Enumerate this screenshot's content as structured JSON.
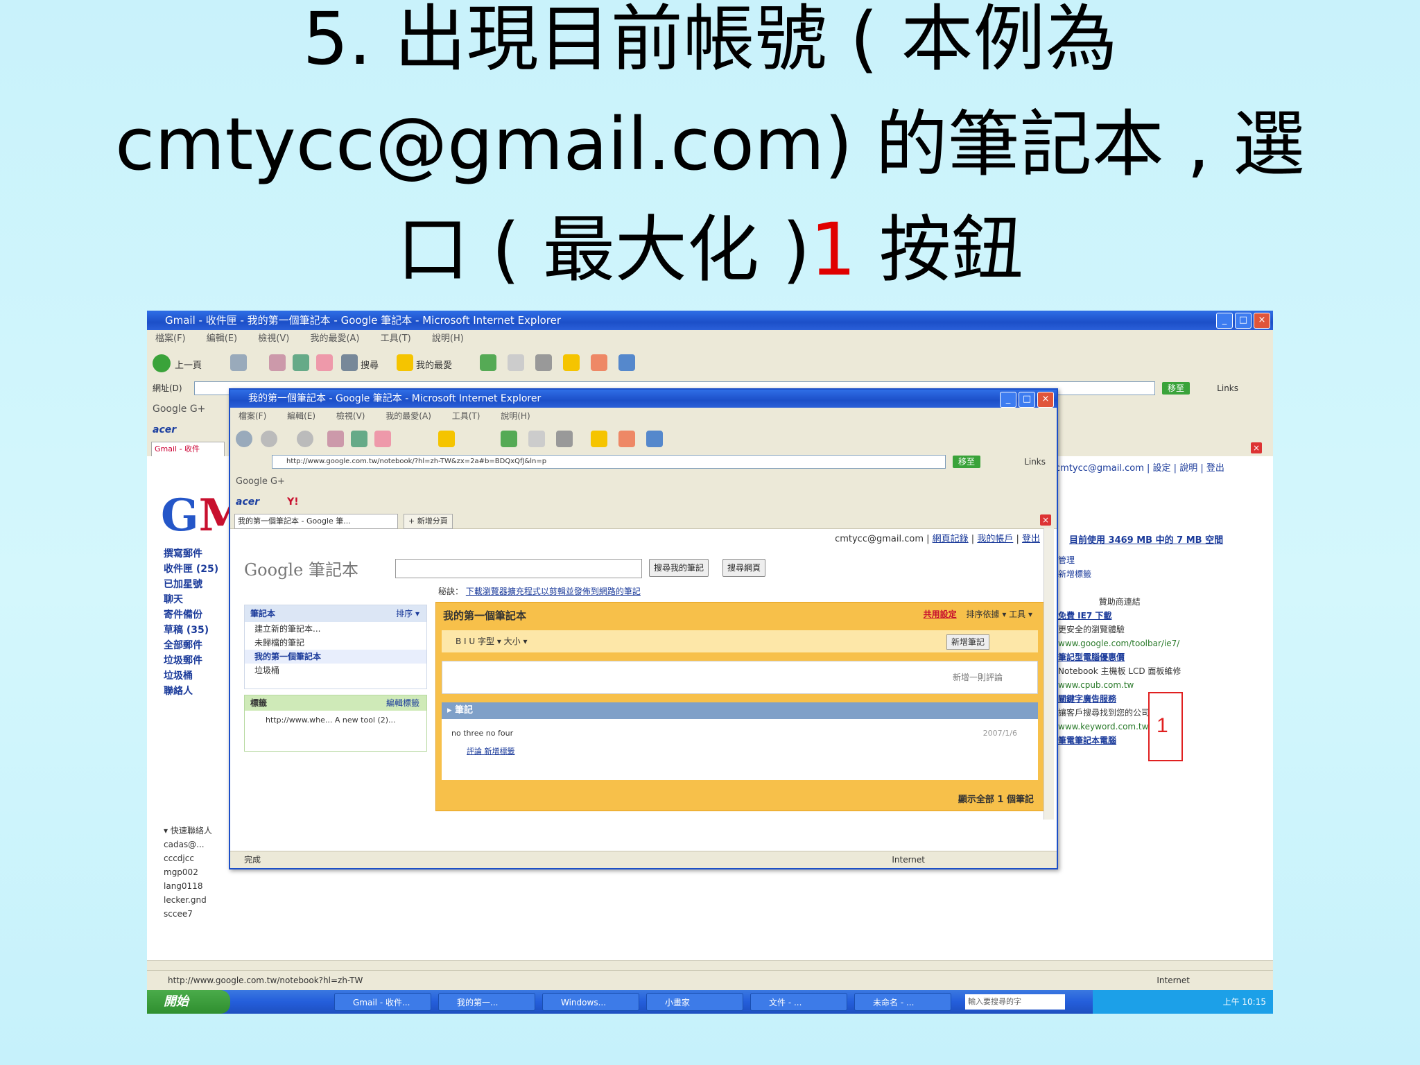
{
  "slide": {
    "title_line1": "5. 出現目前帳號 ( 本例為",
    "title_line2": "cmtycc@gmail.com) 的筆記本 , 選",
    "title_line3_a": "口 ( 最大化 )",
    "title_line3_num": "1",
    "title_line3_b": " 按鈕"
  },
  "outer_window": {
    "title": "Gmail - 收件匣 - 我的第一個筆記本 - Google 筆記本 - Microsoft Internet Explorer",
    "menu": [
      "檔案(F)",
      "編輯(E)",
      "檢視(V)",
      "我的最愛(A)",
      "工具(T)",
      "說明(H)"
    ],
    "back_label": "上一頁",
    "search_label": "搜尋",
    "favorites_label": "我的最愛",
    "address_label": "網址(D)",
    "go_label": "移至",
    "links_label": "Links",
    "google_label": "Google G+",
    "acer_label": "acer",
    "tab_label": "Gmail - 收件",
    "status_url": "http://www.google.com.tw/notebook?hl=zh-TW",
    "status_zone": "Internet"
  },
  "gmail": {
    "logo_g": "G",
    "logo_m": "M",
    "links": [
      "撰寫郵件",
      "收件匣 (25)",
      "已加星號",
      "聊天",
      "寄件備份",
      "草稿 (35)",
      "全部郵件",
      "垃圾郵件",
      "垃圾桶",
      "聯絡人"
    ],
    "contacts_header": "▾ 快速聯絡人",
    "contacts": [
      "cadas@...",
      "cccdjcc",
      "mgp002",
      "lang0118",
      "lecker.gnd",
      "sccee7"
    ],
    "account_line": "cmtycc@gmail.com | 設定 | 說明 | 登出",
    "used": "目前使用 3469 MB 中的 7 MB 空間",
    "manage": [
      "管理",
      "新增標籤"
    ],
    "ads_header": "贊助商連結",
    "ads": [
      {
        "title": "免費 IE7 下載",
        "text": "更安全的瀏覽體驗",
        "url": "www.google.com/toolbar/ie7/"
      },
      {
        "title": "筆記型電腦優惠價",
        "text": "Notebook 主機板 LCD 面板維修",
        "url": "www.cpub.com.tw"
      },
      {
        "title": "關鍵字廣告服務",
        "text": "讓客戶搜尋找到您的公司",
        "url": "www.keyword.com.tw"
      },
      {
        "title": "筆電筆記本電腦",
        "text": "",
        "url": ""
      }
    ]
  },
  "taskbar": {
    "start": "開始",
    "buttons": [
      "Gmail - 收件...",
      "我的第一...",
      "Windows...",
      "小畫家",
      "文件 - ...",
      "未命名 - ..."
    ],
    "search_placeholder": "輸入要搜尋的字",
    "clock": "上午 10:15"
  },
  "notebook_window": {
    "title": "我的第一個筆記本 - Google 筆記本 - Microsoft Internet Explorer",
    "menu": [
      "檔案(F)",
      "編輯(E)",
      "檢視(V)",
      "我的最愛(A)",
      "工具(T)",
      "說明(H)"
    ],
    "address": "http://www.google.com.tw/notebook/?hl=zh-TW&zx=2a#b=BDQxQfJ&ln=p",
    "go_label": "移至",
    "links_label": "Links",
    "google_label": "Google G+",
    "acer_label": "acer",
    "yahoo_label": "Y!",
    "tab_label": "我的第一個筆記本 - Google 筆...",
    "newtab_label": "+ 新增分頁",
    "user_email": "cmtycc@gmail.com",
    "user_links": [
      "網頁記錄",
      "我的帳戶",
      "登出"
    ],
    "logo": "Google 筆記本",
    "search_placeholder": "",
    "search_button": "搜尋我的筆記",
    "web_search_button": "搜尋網頁",
    "hint_prefix": "秘訣：",
    "hint_link": "下載瀏覽器擴充程式以剪輯並發佈到網路的筆記",
    "side_header": "筆記本",
    "side_sort": "排序 ▾",
    "side_rows": [
      "建立新的筆記本...",
      "未歸檔的筆記",
      "我的第一個筆記本",
      "垃圾桶"
    ],
    "label_header": "標籤",
    "label_manage": "編輯標籤",
    "label_body": "http://www.whe... A new tool (2)...",
    "main_header": "我的第一個筆記本",
    "main_share": "共用設定",
    "main_header_right": "排序依據 ▾  工具 ▾",
    "editor_bar": "B  I  U  字型 ▾  大小 ▾",
    "save_label": "新增筆記",
    "editor_placeholder": "新增一則評論",
    "section_header": "▸ 筆記",
    "note_title": "no three no four",
    "note_date": "2007/1/6",
    "note_actions": "評論    新增標籤",
    "footer": "顯示全部 1 個筆記",
    "status": "完成",
    "status_zone": "Internet"
  },
  "callout": {
    "label": "1",
    "color": "#e02020"
  }
}
